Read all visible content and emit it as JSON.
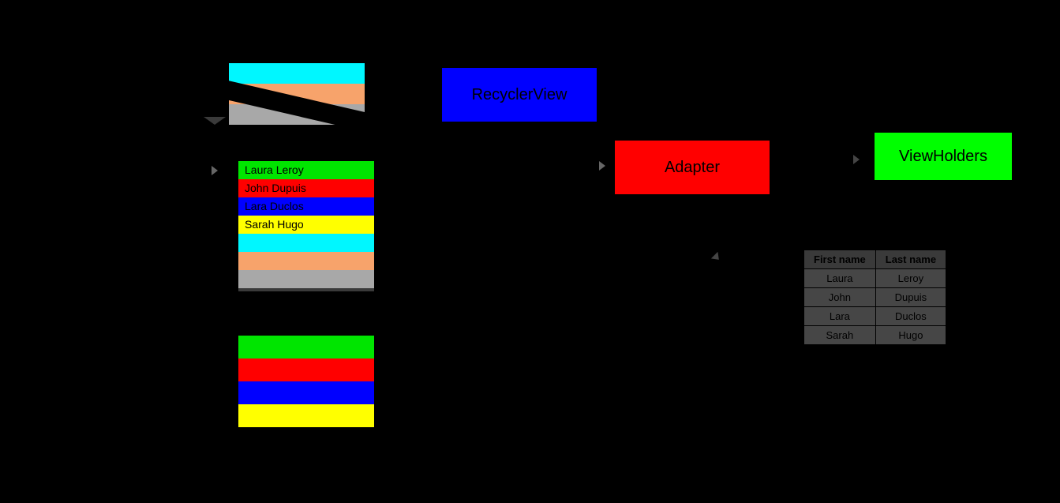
{
  "boxes": {
    "recycler": "RecyclerView",
    "adapter": "Adapter",
    "viewholders": "ViewHolders"
  },
  "list_rows": [
    {
      "label": "Laura Leroy",
      "colorClass": "c-green"
    },
    {
      "label": "John Dupuis",
      "colorClass": "c-red"
    },
    {
      "label": "Lara Duclos",
      "colorClass": "c-blue"
    },
    {
      "label": "Sarah Hugo",
      "colorClass": "c-yellow"
    },
    {
      "label": "",
      "colorClass": "c-cyan"
    },
    {
      "label": "",
      "colorClass": "c-salmon"
    },
    {
      "label": "",
      "colorClass": "c-gray"
    }
  ],
  "persp_strips": [
    "c-cyan",
    "c-salmon",
    "c-gray"
  ],
  "stack_bars": [
    "c-green",
    "c-red",
    "c-blue",
    "c-yellow"
  ],
  "table": {
    "headers": [
      "First name",
      "Last name"
    ],
    "rows": [
      [
        "Laura",
        "Leroy"
      ],
      [
        "John",
        "Dupuis"
      ],
      [
        "Lara",
        "Duclos"
      ],
      [
        "Sarah",
        "Hugo"
      ]
    ]
  }
}
